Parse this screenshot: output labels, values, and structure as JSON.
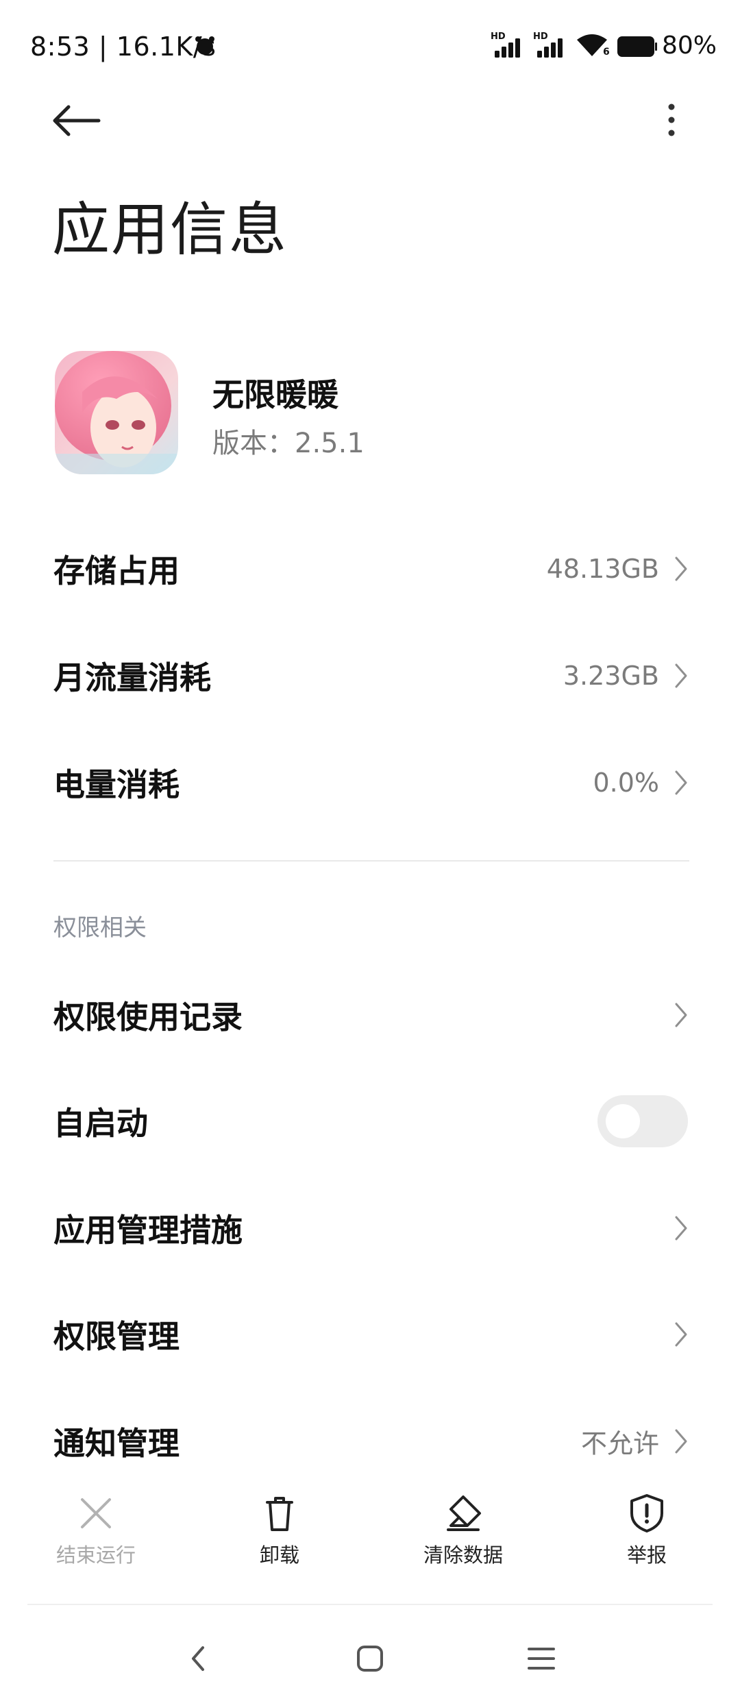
{
  "status_bar": {
    "time_speed": "8:53 | 16.1K/s",
    "signal1_label": "HD",
    "signal2_label": "HD",
    "wifi_badge": "6",
    "battery": "80%"
  },
  "header": {
    "title": "应用信息"
  },
  "app": {
    "name": "无限暖暖",
    "version": "版本：2.5.1"
  },
  "usage_rows": [
    {
      "label": "存储占用",
      "value": "48.13GB"
    },
    {
      "label": "月流量消耗",
      "value": "3.23GB"
    },
    {
      "label": "电量消耗",
      "value": "0.0%"
    }
  ],
  "permissions_section": {
    "title": "权限相关",
    "rows": [
      {
        "label": "权限使用记录",
        "value": ""
      },
      {
        "label": "自启动",
        "toggle_on": false
      },
      {
        "label": "应用管理措施",
        "value": ""
      },
      {
        "label": "权限管理",
        "value": ""
      },
      {
        "label": "通知管理",
        "value": "不允许"
      }
    ]
  },
  "actions": [
    {
      "label": "结束运行",
      "icon": "close-icon",
      "enabled": false
    },
    {
      "label": "卸载",
      "icon": "trash-icon",
      "enabled": true
    },
    {
      "label": "清除数据",
      "icon": "eraser-icon",
      "enabled": true
    },
    {
      "label": "举报",
      "icon": "shield-alert-icon",
      "enabled": true
    }
  ],
  "nav": {
    "back": "back-nav-icon",
    "home": "home-nav-icon",
    "recents": "menu-nav-icon"
  }
}
